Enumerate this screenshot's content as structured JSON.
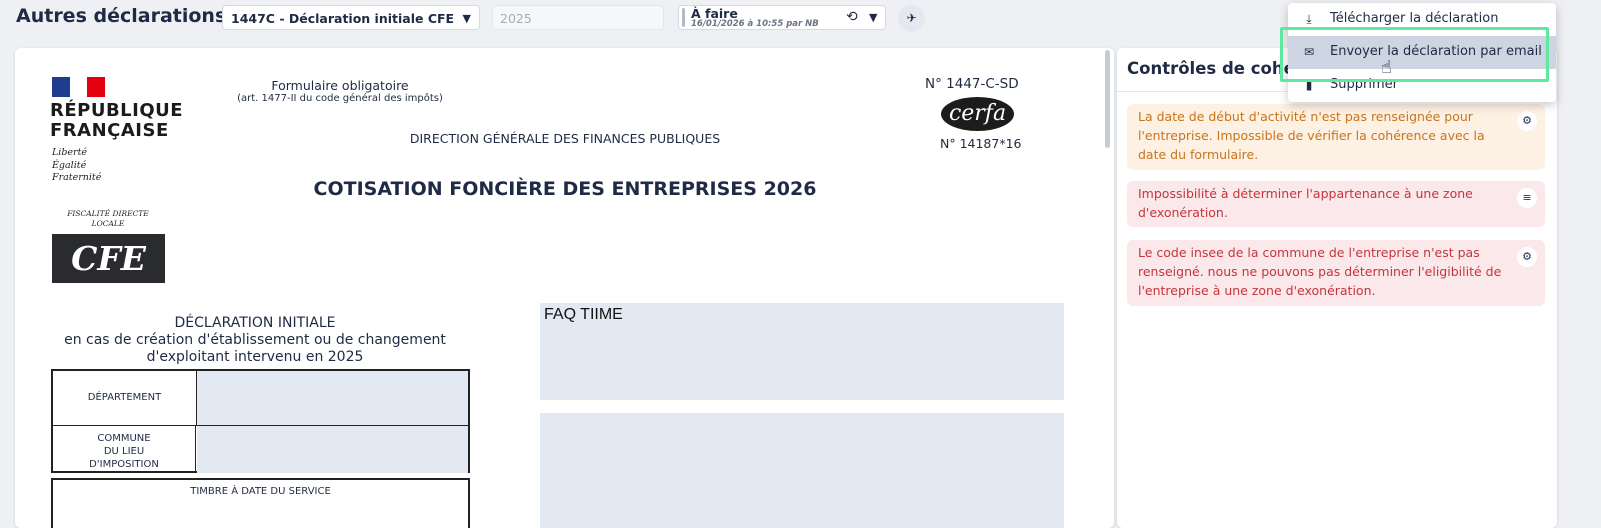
{
  "header": {
    "title": "Autres déclarations",
    "declaration_select": "1447C - Déclaration initiale CFE",
    "year_placeholder": "2025",
    "status_label": "À faire",
    "status_meta": "16/01/2026 à 10:55 par NB"
  },
  "menu": {
    "items": [
      {
        "label": "Télécharger la déclaration",
        "icon": "download-icon"
      },
      {
        "label": "Envoyer la déclaration par email",
        "icon": "mail-icon"
      },
      {
        "label": "Supprimer",
        "icon": "trash-icon"
      }
    ]
  },
  "document": {
    "republic": "RÉPUBLIQUE\nFRANÇAISE",
    "devise": "Liberté\nÉgalité\nFraternité",
    "fiscalite": "FISCALITÉ DIRECTE\nLOCALE",
    "cfe_logo": "CFE",
    "obligatoire": "Formulaire obligatoire",
    "obligatoire_sub": "(art. 1477-II du code général des impôts)",
    "dgfip": "DIRECTION GÉNÉRALE DES FINANCES PUBLIQUES",
    "title": "COTISATION FONCIÈRE DES ENTREPRISES 2026",
    "cerfa_no": "N° 1447-C-SD",
    "cerfa_logo": "cerfa",
    "cerfa_no2": "N° 14187*16",
    "decl_heading": "DÉCLARATION INITIALE\nen cas de création d'établissement ou de changement\nd'exploitant intervenu en 2025",
    "departement": "DÉPARTEMENT",
    "commune": "COMMUNE\nDU LIEU\nD'IMPOSITION",
    "timbre": "TIMBRE À DATE DU SERVICE",
    "faq": "FAQ TIIME"
  },
  "controls": {
    "title": "Contrôles de cohérence",
    "items": [
      {
        "text": "La date de début d'activité n'est pas renseignée pour l'entreprise. Impossible de vérifier la cohérence avec la date du formulaire.",
        "level": "warning",
        "icon": "gear-icon"
      },
      {
        "text": "Impossibilité à déterminer l'appartenance à une zone d'exonération.",
        "level": "error",
        "icon": "search-list-icon"
      },
      {
        "text": "Le code insee de la commune de l'entreprise n'est pas renseigné. nous ne pouvons pas déterminer l'eligibilité de l'entreprise à une zone d'exonération.",
        "level": "error",
        "icon": "gear-icon"
      }
    ]
  },
  "colors": {
    "warning_bg": "#fdf1e3",
    "warning_text": "#c8741c",
    "error_bg": "#fbe8ea",
    "error_text": "#c6353d",
    "highlight": "#5fe8a0"
  }
}
